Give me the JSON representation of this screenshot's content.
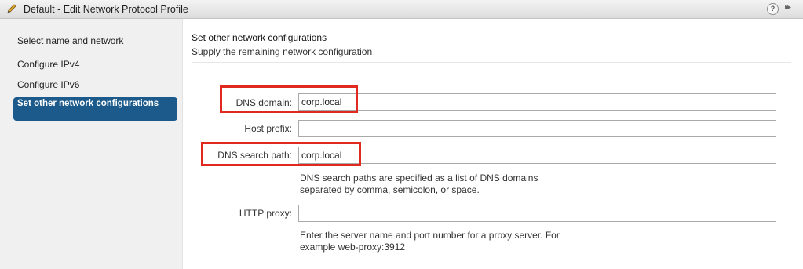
{
  "window": {
    "title": "Default - Edit Network Protocol Profile",
    "help_glyph": "?",
    "expand_glyph": "▸▸"
  },
  "sidebar": {
    "steps": [
      {
        "label": "Select name and network"
      },
      {
        "label": "Configure IPv4"
      },
      {
        "label": "Configure IPv6"
      },
      {
        "label": "Set other network configurations",
        "active": true
      }
    ]
  },
  "main": {
    "title": "Set other network configurations",
    "subtitle": "Supply the remaining network configuration",
    "fields": {
      "dns_domain": {
        "label": "DNS domain:",
        "value": "corp.local",
        "highlighted": true
      },
      "host_prefix": {
        "label": "Host prefix:",
        "value": ""
      },
      "dns_search_path": {
        "label": "DNS search path:",
        "value": "corp.local",
        "highlighted": true,
        "hint_line1": "DNS search paths are specified as a list of DNS domains",
        "hint_line2": "separated by comma, semicolon, or space."
      },
      "http_proxy": {
        "label": "HTTP proxy:",
        "value": "",
        "hint_line1": "Enter the server name and port number for a proxy server. For",
        "hint_line2": "example web-proxy:3912"
      }
    }
  },
  "colors": {
    "active_step_bg": "#1b5a8a",
    "highlight_box": "#e12a1f"
  }
}
